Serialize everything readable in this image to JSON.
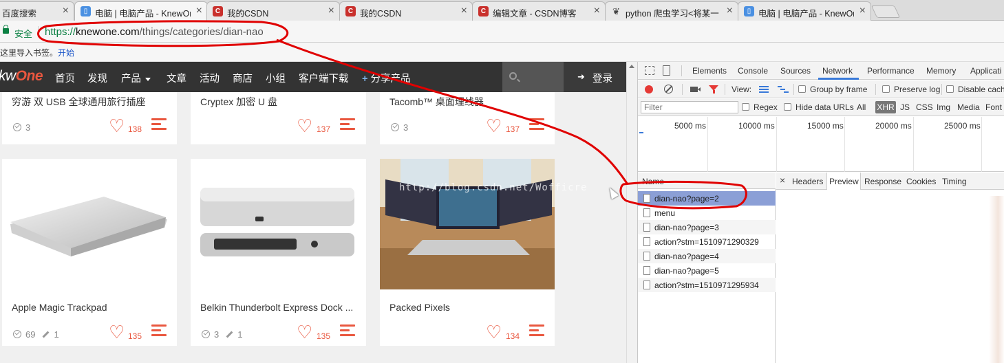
{
  "browser": {
    "tabs": [
      {
        "title": "百度搜索",
        "favicon": "baidu",
        "fav_color": "#2932e1"
      },
      {
        "title": "电脑 | 电脑产品 - KnewOne",
        "favicon": "bookmark",
        "fav_color": "#4a90e2",
        "active": true
      },
      {
        "title": "我的CSDN",
        "favicon": "csdn",
        "fav_color": "#c9302c"
      },
      {
        "title": "我的CSDN",
        "favicon": "csdn",
        "fav_color": "#c9302c"
      },
      {
        "title": "编辑文章 - CSDN博客",
        "favicon": "csdn",
        "fav_color": "#c9302c"
      },
      {
        "title": "python 爬虫学习<将某一",
        "favicon": "github",
        "fav_color": "#555555"
      },
      {
        "title": "电脑 | 电脑产品 - KnewOne",
        "favicon": "bookmark",
        "fav_color": "#4a90e2"
      }
    ],
    "tab_close_glyph": "×",
    "security_label": "安全",
    "url_scheme": "https://",
    "url_host": "knewone.com",
    "url_path": "/things/categories/dian-nao",
    "bookmarks_text": "这里导入书签。",
    "bookmarks_link": "开始"
  },
  "site": {
    "logo_prefix": "kw",
    "logo_suffix": "One",
    "nav": [
      "首页",
      "发现",
      "产品",
      "文章",
      "活动",
      "商店",
      "小组",
      "客户端下载"
    ],
    "share_label": "分享产品",
    "share_glyph": "+",
    "login_label": "登录",
    "login_glyph": "➜",
    "accent_color": "#e9573f",
    "nav_bg": "#333333"
  },
  "cards": [
    {
      "title": "穷游 双 USB 全球通用旅行插座",
      "checks": "3",
      "likes": "138"
    },
    {
      "title": "Cryptex 加密 U 盘",
      "likes": "137"
    },
    {
      "title": "Tacomb™ 桌面理线器",
      "checks": "3",
      "likes": "137"
    },
    {
      "title": "Apple Magic Trackpad",
      "checks": "69",
      "edits": "1",
      "likes": "135"
    },
    {
      "title": "Belkin Thunderbolt Express Dock ...",
      "checks": "3",
      "edits": "1",
      "likes": "135"
    },
    {
      "title": "Packed Pixels",
      "likes": "134"
    }
  ],
  "watermark": "http://blog.csdn.net/Wofficre",
  "devtools": {
    "tabs": [
      "Elements",
      "Console",
      "Sources",
      "Network",
      "Performance",
      "Memory",
      "Applicati"
    ],
    "active_tab": "Network",
    "view_label": "View:",
    "group_by_frame": "Group by frame",
    "preserve_log": "Preserve log",
    "disable_cache": "Disable cach",
    "filter_placeholder": "Filter",
    "regex": "Regex",
    "hide_data_urls": "Hide data URLs",
    "types": [
      "All",
      "XHR",
      "JS",
      "CSS",
      "Img",
      "Media",
      "Font"
    ],
    "selected_type": "XHR",
    "timeline_ticks": [
      "5000 ms",
      "10000 ms",
      "15000 ms",
      "20000 ms",
      "25000 ms"
    ],
    "name_header": "Name",
    "requests": [
      "dian-nao?page=2",
      "menu",
      "dian-nao?page=3",
      "action?stm=1510971290329",
      "dian-nao?page=4",
      "dian-nao?page=5",
      "action?stm=1510971295934"
    ],
    "selected_request": "dian-nao?page=2",
    "detail_close": "×",
    "detail_tabs": [
      "Headers",
      "Preview",
      "Response",
      "Cookies",
      "Timing"
    ],
    "active_detail_tab": "Preview"
  },
  "annotation_color": "#e00000"
}
